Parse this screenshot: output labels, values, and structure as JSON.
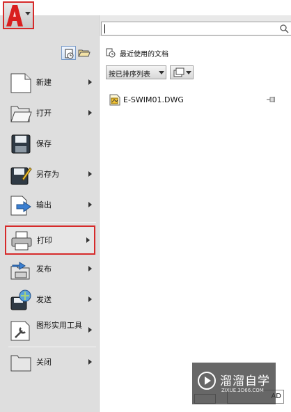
{
  "app_menu": {
    "button_icon": "autocad-a-logo",
    "search": {
      "value": "",
      "placeholder": ""
    },
    "view_toggle": [
      "recent-documents-icon",
      "open-documents-icon"
    ],
    "items": [
      {
        "label": "新建",
        "icon": "new-document-icon",
        "has_submenu": true
      },
      {
        "label": "打开",
        "icon": "open-folder-icon",
        "has_submenu": true
      },
      {
        "label": "保存",
        "icon": "save-disk-icon",
        "has_submenu": false
      },
      {
        "label": "另存为",
        "icon": "save-as-icon",
        "has_submenu": true
      },
      {
        "label": "输出",
        "icon": "export-icon",
        "has_submenu": true
      },
      {
        "label": "打印",
        "icon": "print-icon",
        "has_submenu": true,
        "highlighted": true
      },
      {
        "label": "发布",
        "icon": "publish-icon",
        "has_submenu": true
      },
      {
        "label": "发送",
        "icon": "send-icon",
        "has_submenu": true
      },
      {
        "label": "图形实用工具",
        "icon": "drawing-utilities-icon",
        "has_submenu": true
      },
      {
        "label": "关闭",
        "icon": "close-document-icon",
        "has_submenu": true
      }
    ]
  },
  "recent_panel": {
    "title": "最近使用的文档",
    "sort_label": "按已排序列表",
    "display_icon": "large-icons-icon",
    "files": [
      {
        "name": "E-SWIM01.DWG",
        "icon": "dwg-file-icon",
        "pinned": false
      }
    ]
  },
  "bottom_button_text": "AD",
  "watermark": {
    "title": "溜溜自学",
    "subtitle": "ZIXUE.3D66.COM"
  },
  "colors": {
    "highlight_border": "#d62a2a",
    "menu_background": "#dedede",
    "panel_background": "#ffffff"
  }
}
